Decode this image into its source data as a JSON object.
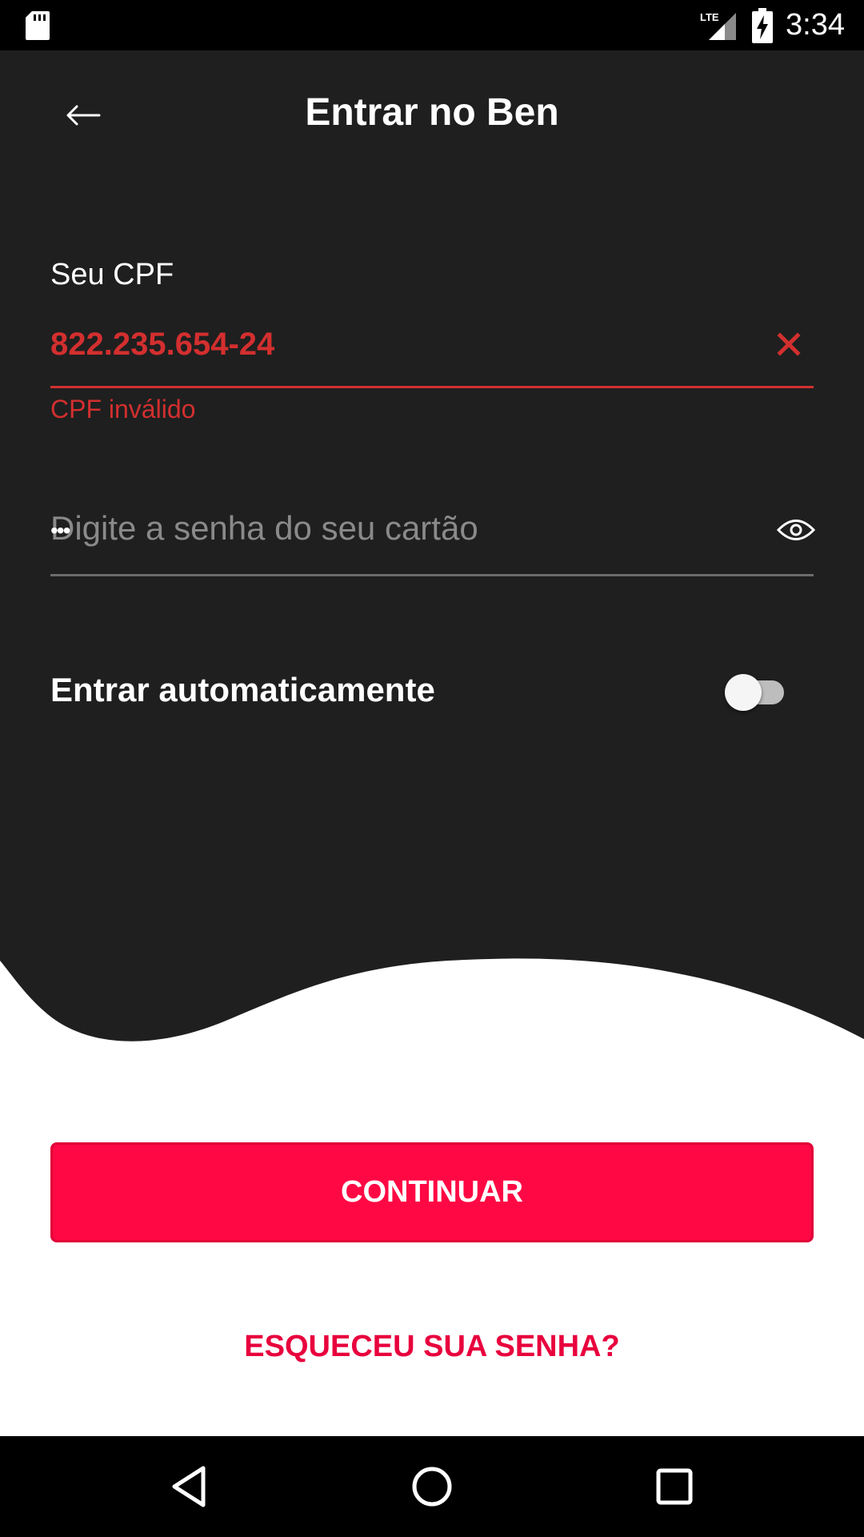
{
  "status_bar": {
    "time": "3:34",
    "network": "LTE",
    "icons": [
      "sd-card-icon",
      "lte-signal-icon",
      "battery-charging-icon"
    ]
  },
  "header": {
    "title": "Entrar no Ben",
    "back_icon": "arrow-left-icon"
  },
  "cpf_field": {
    "label": "Seu CPF",
    "value": "822.235.654-24",
    "error": "CPF inválido",
    "clear_icon": "close-icon"
  },
  "password_field": {
    "placeholder": "Digite a senha do seu cartão",
    "masked_value": "•••",
    "visibility_icon": "eye-icon"
  },
  "auto_login": {
    "label": "Entrar automaticamente",
    "enabled": false
  },
  "actions": {
    "continue_label": "CONTINUAR",
    "forgot_password_label": "ESQUECEU SUA SENHA?"
  },
  "nav_bar": {
    "icons": [
      "back-triangle-icon",
      "home-circle-icon",
      "recents-square-icon"
    ]
  },
  "colors": {
    "dark_background": "#1f1f1f",
    "error_red": "#d32f2f",
    "brand_pink": "#ff0844",
    "link_pink": "#e8003d"
  }
}
